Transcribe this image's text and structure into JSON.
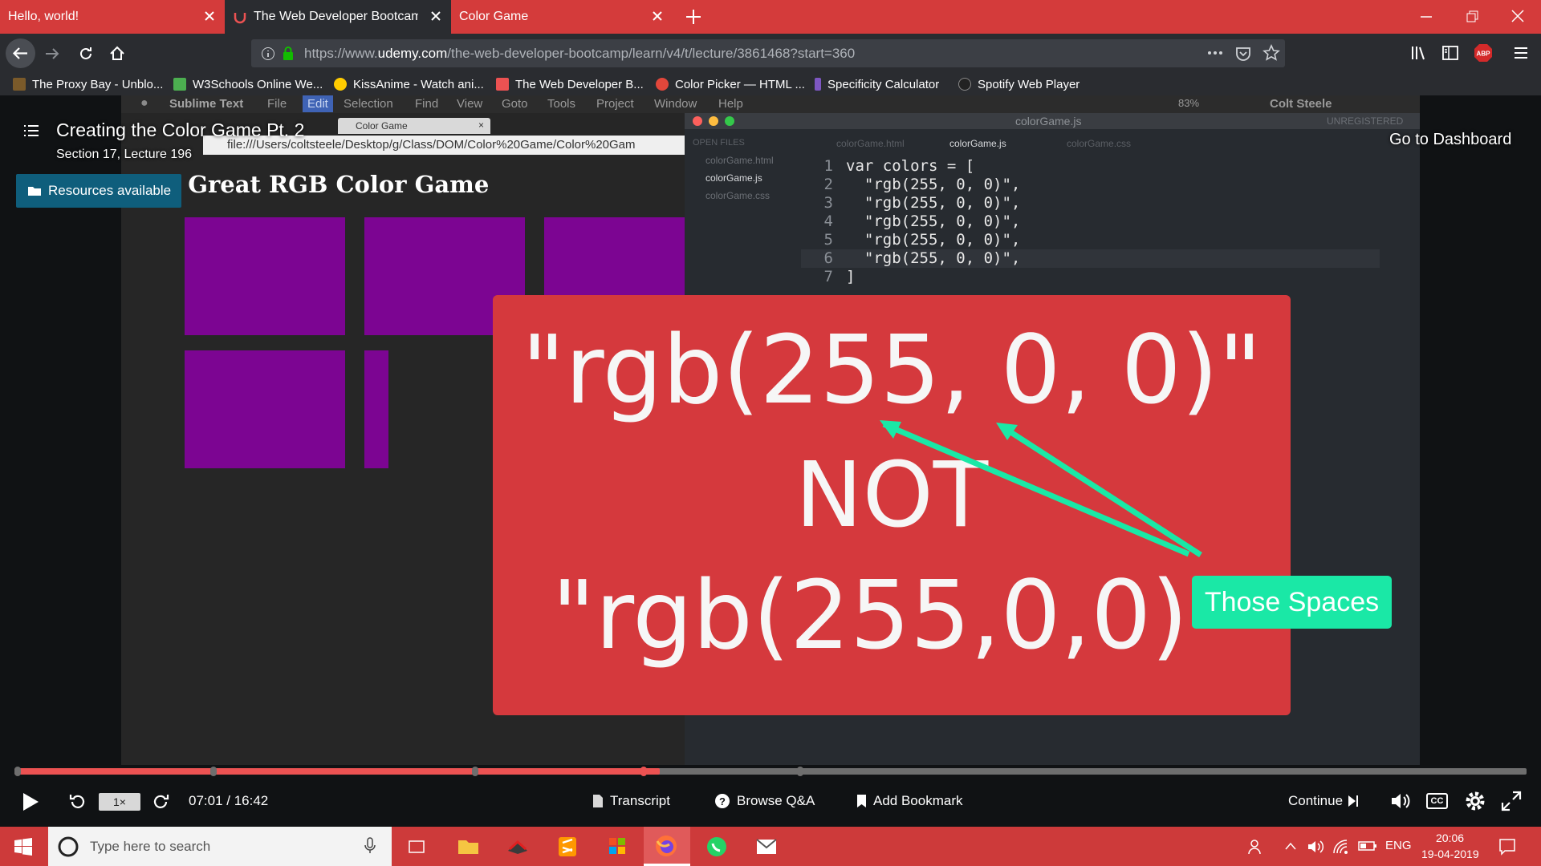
{
  "browser": {
    "tabs": [
      {
        "label": "Hello, world!"
      },
      {
        "label": "The Web Developer Bootcamp"
      },
      {
        "label": "Color Game"
      }
    ],
    "url_prefix": "https://www.",
    "url_domain": "udemy.com",
    "url_path": "/the-web-developer-bootcamp/learn/v4/t/lecture/3861468?start=360",
    "bookmarks": [
      {
        "label": "The Proxy Bay - Unblo...",
        "icon": "pirate-icon",
        "color": "#7a5a2a"
      },
      {
        "label": "W3Schools Online We...",
        "icon": "w3-icon",
        "color": "#4caf50"
      },
      {
        "label": "KissAnime - Watch ani...",
        "icon": "kiss-icon",
        "color": "#ffcc00"
      },
      {
        "label": "The Web Developer B...",
        "icon": "udemy-icon",
        "color": "#ec5252"
      },
      {
        "label": "Color Picker — HTML ...",
        "icon": "colorpicker-icon",
        "color": "#e2473b"
      },
      {
        "label": "Specificity Calculator",
        "icon": "specificity-icon",
        "color": "#7e57c2"
      },
      {
        "label": "Spotify Web Player",
        "icon": "spotify-icon",
        "color": "#222"
      }
    ]
  },
  "lecture": {
    "title": "Creating the Color Game Pt. 2",
    "subtitle": "Section 17, Lecture 196",
    "resources": "Resources available",
    "dashboard": "Go to Dashboard"
  },
  "video_frame": {
    "mac_menu": [
      "Sublime Text",
      "File",
      "Edit",
      "Selection",
      "Find",
      "View",
      "Goto",
      "Tools",
      "Project",
      "Window",
      "Help"
    ],
    "mac_right": {
      "battery": "83%",
      "user": "Colt Steele"
    },
    "inner_tab": "Color Game",
    "inner_url": "file:///Users/coltsteele/Desktop/g/Class/DOM/Color%20Game/Color%20Gam",
    "page_heading": "The Great RGB Color Game",
    "square_color": "#7c0592",
    "editor_title": "colorGame.js",
    "editor_status": "UNREGISTERED",
    "open_files_label": "OPEN FILES",
    "sidebar_files": [
      "colorGame.html",
      "colorGame.js",
      "colorGame.css"
    ],
    "editor_tabs": [
      "colorGame.html",
      "colorGame.js",
      "colorGame.css"
    ],
    "code_lines": [
      {
        "n": "1",
        "text": "var colors = ["
      },
      {
        "n": "2",
        "text": "  \"rgb(255, 0, 0)\","
      },
      {
        "n": "3",
        "text": "  \"rgb(255, 0, 0)\","
      },
      {
        "n": "4",
        "text": "  \"rgb(255, 0, 0)\","
      },
      {
        "n": "5",
        "text": "  \"rgb(255, 0, 0)\","
      },
      {
        "n": "6",
        "text": "  \"rgb(255, 0, 0)\","
      },
      {
        "n": "7",
        "text": "]"
      }
    ],
    "callout_line1": "\"rgb(255, 0, 0)\"",
    "callout_line2": "NOT",
    "callout_line3": "\"rgb(255,0,0)\"",
    "callout_color": "#d5393d",
    "note_label": "Those Spaces",
    "note_color": "#1ae8a6"
  },
  "player": {
    "progress": 0.427,
    "speed": "1×",
    "time": "07:01 / 16:42",
    "transcript": "Transcript",
    "browse_qa": "Browse Q&A",
    "bookmark": "Add Bookmark",
    "continue": "Continue",
    "accent": "#ec5252"
  },
  "taskbar": {
    "search_placeholder": "Type here to search",
    "lang": "ENG",
    "time": "20:06",
    "date": "19-04-2019",
    "color": "#cd3a3a"
  }
}
